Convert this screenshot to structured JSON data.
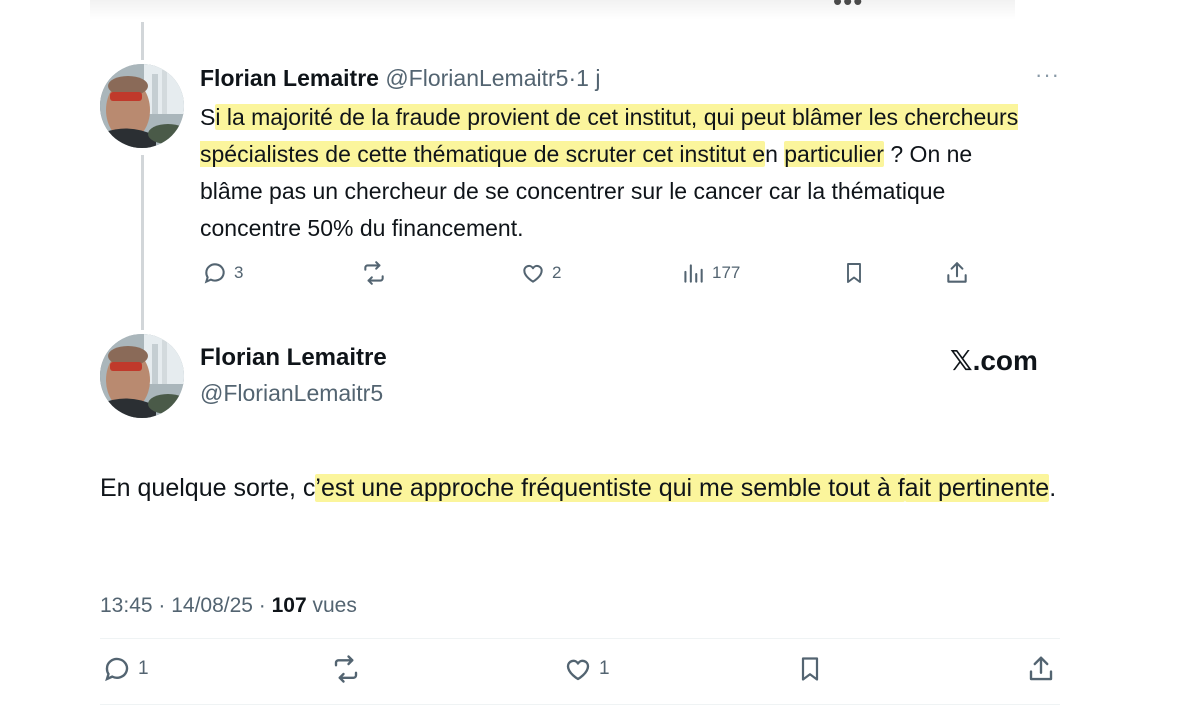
{
  "top": {
    "more_dots": "•••",
    "corner_mark": "'"
  },
  "reply": {
    "name": "Florian Lemaitre",
    "handle": "@FlorianLemaitr5",
    "separator": "·",
    "time": "1 j",
    "more": "···",
    "text_parts": [
      "S",
      "i la majorité de la fraude provient de cet institut, qui peut blâmer les chercheurs spécialistes de cette thématique de scruter cet institut e",
      "n ",
      "particulier",
      " ? On ne blâme pas un chercheur de se concentrer sur le cancer car la thématique concentre 50% du financement."
    ],
    "actions": {
      "replies": "3",
      "reposts": "",
      "likes": "2",
      "views": "177"
    }
  },
  "main": {
    "name": "Florian Lemaitre",
    "handle": "@FlorianLemaitr5",
    "brand_x": "𝕏",
    "brand_domain": ".com",
    "text_parts": [
      "En quelque sorte, c",
      "’est une approche fréquentiste qui me semble tout à f",
      "ait pertinente",
      "."
    ],
    "timestamp": "13:45 · 14/08/25 · ",
    "views_count": "107",
    "views_label": " vues",
    "actions": {
      "replies": "1",
      "reposts": "",
      "likes": "1"
    }
  },
  "colors": {
    "highlight": "#fbf59c",
    "secondary_text": "#536471",
    "thread_line": "#d2d6d9"
  },
  "icons": [
    "reply-icon",
    "repost-icon",
    "like-icon",
    "views-icon",
    "bookmark-icon",
    "share-icon"
  ]
}
